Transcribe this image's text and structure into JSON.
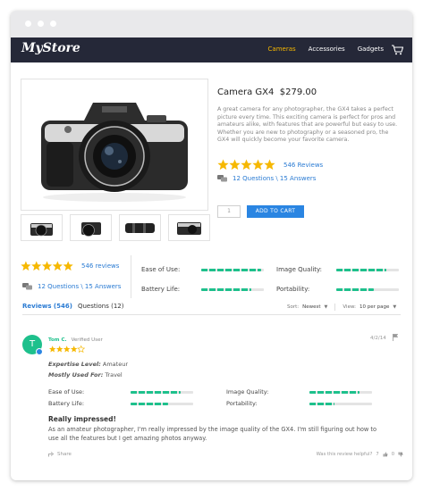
{
  "nav": {
    "logo": "MyStore",
    "links": [
      "Cameras",
      "Accessories",
      "Gadgets"
    ],
    "active": "Cameras"
  },
  "product": {
    "name": "Camera GX4",
    "price": "$279.00",
    "description": "A great camera for any photographer, the GX4 takes a perfect picture every time. This exciting camera is perfect for pros and amateurs alike, with features that are powerful but easy to use. Whether you are new to photography or a seasoned pro, the GX4 will quickly become your favorite camera.",
    "rating": 5,
    "reviews_link": "546 Reviews",
    "qa_link": "12 Questions \\ 15 Answers",
    "quantity": "1",
    "add_to_cart": "ADD TO CART"
  },
  "summary": {
    "rating": 5,
    "reviews_link": "546 reviews",
    "qa_link": "12 Questions \\ 15 Answers",
    "metrics": [
      {
        "label": "Ease of Use:",
        "value": 0.95
      },
      {
        "label": "Image Quality:",
        "value": 0.8
      },
      {
        "label": "Battery Life:",
        "value": 0.8
      },
      {
        "label": "Portability:",
        "value": 0.6
      }
    ]
  },
  "tabs": {
    "reviews": "Reviews",
    "reviews_count": "(546)",
    "questions": "Questions (12)",
    "sort_label": "Sort:",
    "sort_value": "Newest",
    "view_label": "View:",
    "view_value": "10 per page"
  },
  "review": {
    "avatar": "T",
    "author": "Tom C.",
    "verified": "Verified User",
    "date": "4/2/14",
    "rating": 4,
    "expertise_label": "Expertise Level:",
    "expertise_value": "Amateur",
    "used_label": "Mostly Used For:",
    "used_value": "Travel",
    "metrics": [
      {
        "label": "Ease of Use:",
        "value": 0.8
      },
      {
        "label": "Image Quality:",
        "value": 0.8
      },
      {
        "label": "Battery Life:",
        "value": 0.6
      },
      {
        "label": "Portability:",
        "value": 0.4
      }
    ],
    "headline": "Really impressed!",
    "body": "As an amateur photographer, I'm really impressed by the image quality of the GX4. I'm still figuring out how to use all the features but I get amazing photos anyway.",
    "share": "Share",
    "helpful": "Was this review helpful?",
    "helpful_yes": "7",
    "helpful_no": "0"
  },
  "colors": {
    "accent": "#2a85e2",
    "nav_bg": "#252838",
    "active_link": "#f6b800",
    "star": "#f6b800",
    "bar": "#1ec08c"
  }
}
